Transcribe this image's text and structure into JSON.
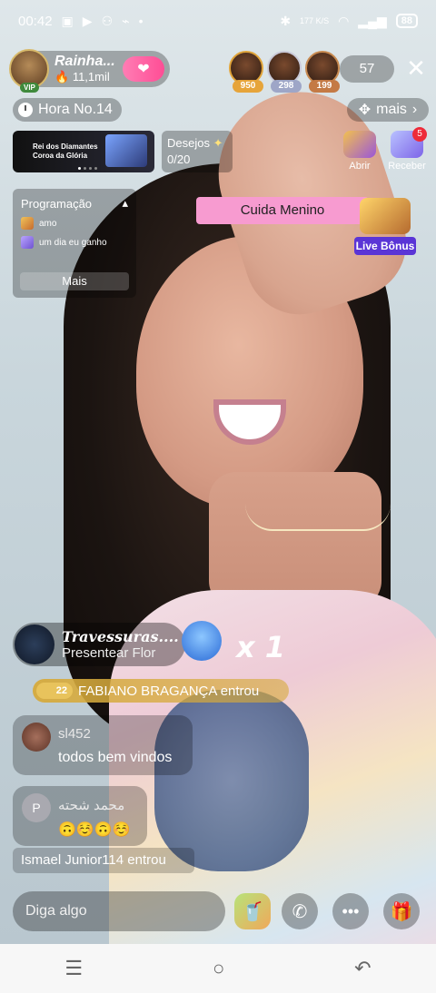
{
  "status_bar": {
    "time": "00:42",
    "left_icons": [
      "vibration-icon",
      "video-icon",
      "sim-icon",
      "broom-icon",
      "dot-icon"
    ],
    "network_speed": "177 K/S",
    "battery": "88"
  },
  "host": {
    "name": "Rainha...",
    "fans": "11,1mil",
    "vip": "VIP",
    "follow_icon": "wings-heart-icon"
  },
  "top_viewers": [
    {
      "badge": "950"
    },
    {
      "badge": "298"
    },
    {
      "badge": "199"
    }
  ],
  "viewer_count": "57",
  "hora": "Hora No.14",
  "mais_label": "mais",
  "banner": {
    "line1": "Rei dos Diamantes",
    "line2": "Coroa da Glória"
  },
  "desejos": {
    "title": "Desejos",
    "count": "0/20"
  },
  "abrir_label": "Abrir",
  "receber_label": "Receber",
  "receber_badge": "5",
  "programacao": {
    "title": "Programação",
    "items": [
      "amo",
      "um dia eu ganho"
    ],
    "more": "Mais"
  },
  "pink_tag": "Cuida Menino",
  "live_bonus": "Live Bônus",
  "gift_notification": {
    "name": "Travessuras....",
    "action": "Presentear Flor",
    "count": "x 1"
  },
  "entered_banner": {
    "level": "22",
    "text": "FABIANO BRAGANÇA entrou"
  },
  "chat": [
    {
      "user": "sl452",
      "message": "todos bem vindos",
      "avatar_letter": ""
    },
    {
      "user": "محمد شحته",
      "message": "🙃☺️🙃☺️",
      "avatar_letter": "P"
    }
  ],
  "system_message": "Ismael Junior114 entrou",
  "input_placeholder": "Diga algo",
  "nav": {
    "menu": "☰",
    "home": "○",
    "back": "↶"
  }
}
